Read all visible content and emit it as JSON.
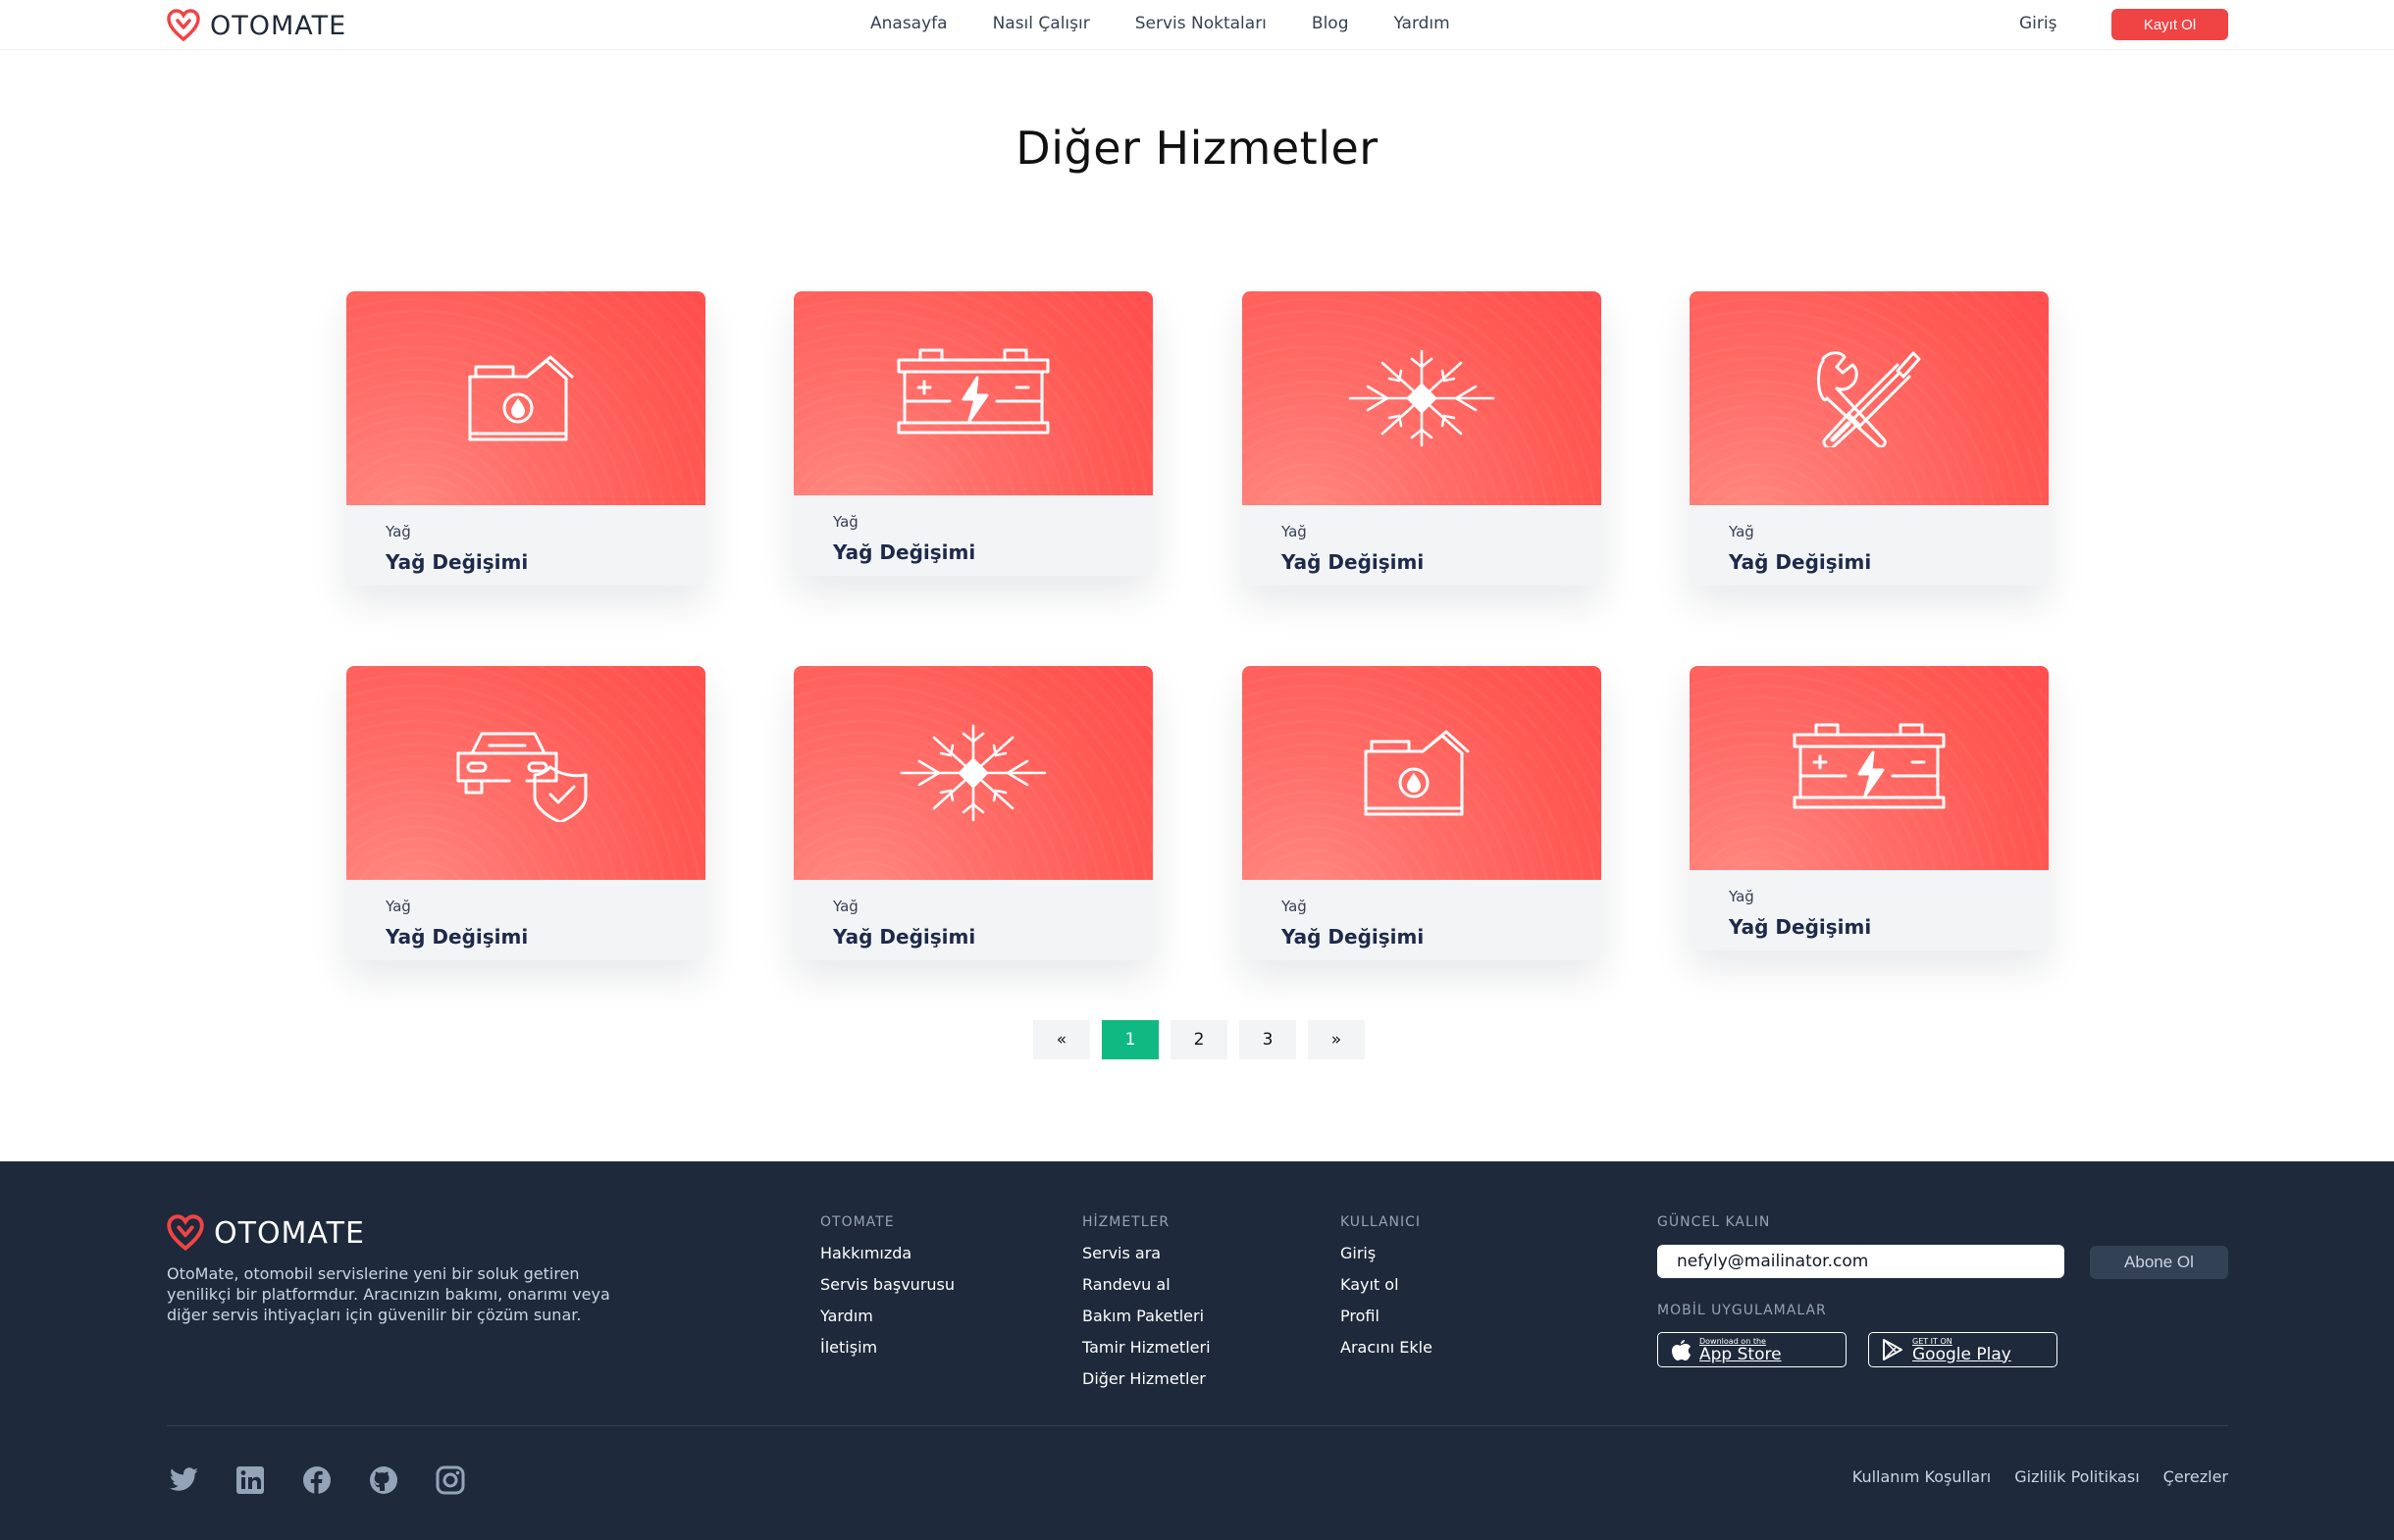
{
  "brand": {
    "name": "OTOMATE",
    "accent_color": "#f04444",
    "pagination_active_color": "#10b981",
    "footer_bg": "#1e293b"
  },
  "header": {
    "nav": [
      "Anasayfa",
      "Nasıl Çalışır",
      "Servis Noktaları",
      "Blog",
      "Yardım"
    ],
    "login_label": "Giriş",
    "signup_label": "Kayıt Ol"
  },
  "main": {
    "title": "Diğer Hizmetler",
    "cards": [
      {
        "icon": "oil-can-icon",
        "category": "Yağ",
        "title": "Yağ Değişimi"
      },
      {
        "icon": "car-battery-icon",
        "category": "Yağ",
        "title": "Yağ Değişimi"
      },
      {
        "icon": "snowflake-icon",
        "category": "Yağ",
        "title": "Yağ Değişimi"
      },
      {
        "icon": "wrench-screwdriver-icon",
        "category": "Yağ",
        "title": "Yağ Değişimi"
      },
      {
        "icon": "car-shield-icon",
        "category": "Yağ",
        "title": "Yağ Değişimi"
      },
      {
        "icon": "snowflake-icon",
        "category": "Yağ",
        "title": "Yağ Değişimi"
      },
      {
        "icon": "oil-can-icon",
        "category": "Yağ",
        "title": "Yağ Değişimi"
      },
      {
        "icon": "car-battery-icon",
        "category": "Yağ",
        "title": "Yağ Değişimi"
      }
    ],
    "pagination": {
      "prev": "«",
      "pages": [
        "1",
        "2",
        "3"
      ],
      "next": "»",
      "current": "1"
    }
  },
  "footer": {
    "description": "OtoMate, otomobil servislerine yeni bir soluk getiren yenilikçi bir platformdur. Aracınızın bakımı, onarımı veya diğer servis ihtiyaçları için güvenilir bir çözüm sunar.",
    "columns": [
      {
        "title": "OTOMATE",
        "links": [
          "Hakkımızda",
          "Servis başvurusu",
          "Yardım",
          "İletişim"
        ]
      },
      {
        "title": "HİZMETLER",
        "links": [
          "Servis ara",
          "Randevu al",
          "Bakım Paketleri",
          "Tamir Hizmetleri",
          "Diğer Hizmetler"
        ]
      },
      {
        "title": "KULLANICI",
        "links": [
          "Giriş",
          "Kayıt ol",
          "Profil",
          "Aracını Ekle"
        ]
      }
    ],
    "newsletter_title": "GÜNCEL KALIN",
    "email_value": "nefyly@mailinator.com",
    "subscribe_label": "Abone Ol",
    "mobile_title": "MOBİL UYGULAMALAR",
    "app_store": {
      "small": "Download on the",
      "big": "App Store"
    },
    "google_play": {
      "small": "GET IT ON",
      "big": "Google Play"
    },
    "social_icons": [
      "twitter-icon",
      "linkedin-icon",
      "facebook-icon",
      "github-icon",
      "instagram-icon"
    ],
    "legal_links": [
      "Kullanım Koşulları",
      "Gizlilik Politikası",
      "Çerezler"
    ]
  }
}
